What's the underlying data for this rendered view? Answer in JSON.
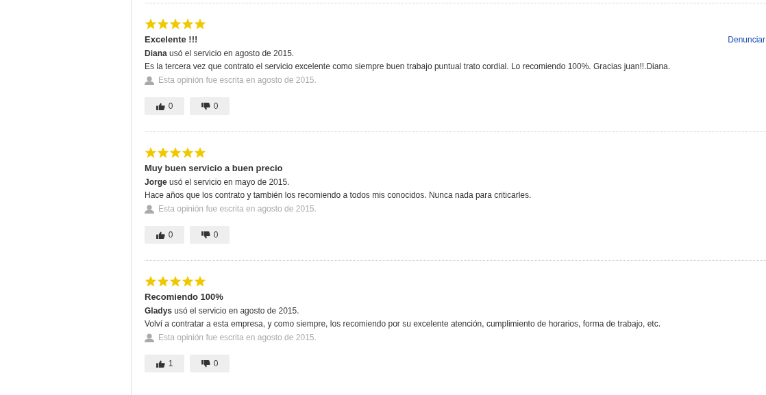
{
  "reviews": [
    {
      "stars": 5,
      "title": "Excelente !!!",
      "report": "Denunciar",
      "author": "**Diana** usó el servicio en agosto de 2015.",
      "body": "Es la tercera vez que contrato el servicio excelente como siempre buen trabajo puntual trato cordial. Lo recomiendo 100%. Gracias juan!!.Diana.",
      "meta": "Esta opinión fue escrita en agosto de 2015.",
      "likes": "0",
      "dislikes": "0"
    },
    {
      "stars": 5,
      "title": "Muy buen servicio a buen precio",
      "author": "**Jorge** usó el servicio en mayo de 2015.",
      "body": "Hace años que los contrato y también los recomiendo a todos mis conocidos. Nunca nada para criticarles.",
      "meta": "Esta opinión fue escrita en agosto de 2015.",
      "likes": "0",
      "dislikes": "0"
    },
    {
      "stars": 5,
      "title": "Recomiendo 100%",
      "author": "**Gladys** usó el servicio en agosto de 2015.",
      "body": "Volví a contratar a esta empresa, y como siempre, los recomiendo por su excelente atención, cumplimiento de horarios, forma de trabajo, etc.",
      "meta": "Esta opinión fue escrita en agosto de 2015.",
      "likes": "1",
      "dislikes": "0"
    }
  ]
}
